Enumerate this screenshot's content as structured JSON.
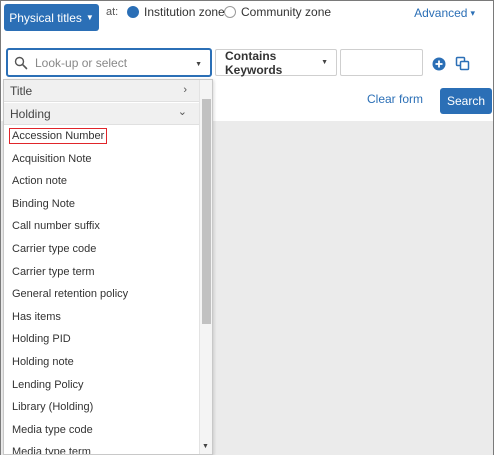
{
  "topbar": {
    "scope_button_label": "Physical titles",
    "at_label": "at:",
    "radio_institution": "Institution zone",
    "radio_community": "Community zone",
    "advanced_label": "Advanced"
  },
  "search": {
    "lookup_placeholder": "Look-up or select",
    "condition_label": "Contains Keywords",
    "value": "",
    "clear_form_label": "Clear form",
    "search_button_label": "Search"
  },
  "dropdown": {
    "groups": [
      {
        "label": "Title",
        "expanded": false
      },
      {
        "label": "Holding",
        "expanded": true
      }
    ],
    "items": [
      "Accession Number",
      "Acquisition Note",
      "Action note",
      "Binding Note",
      "Call number suffix",
      "Carrier type code",
      "Carrier type term",
      "General retention policy",
      "Has items",
      "Holding PID",
      "Holding note",
      "Lending Policy",
      "Library (Holding)",
      "Media type code",
      "Media type term"
    ],
    "highlighted_item": "Accession Number"
  },
  "icons": {
    "search": "magnifier-icon",
    "add": "plus-circle-icon",
    "copy": "duplicate-icon"
  },
  "colors": {
    "accent": "#2b6fb6",
    "highlight_border": "#e0252a",
    "background_panel": "#ebebeb"
  }
}
